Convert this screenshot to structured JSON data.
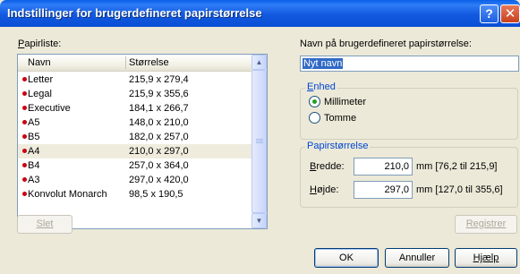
{
  "window": {
    "title": "Indstillinger for brugerdefineret papirstørrelse",
    "help_glyph": "?",
    "close_glyph": "✕"
  },
  "paper_list": {
    "label": "Papirliste:",
    "columns": [
      "Navn",
      "Størrelse"
    ],
    "rows": [
      {
        "name": "Letter",
        "size": "215,9 x 279,4"
      },
      {
        "name": "Legal",
        "size": "215,9 x 355,6"
      },
      {
        "name": "Executive",
        "size": "184,1 x 266,7"
      },
      {
        "name": "A5",
        "size": "148,0 x 210,0"
      },
      {
        "name": "B5",
        "size": "182,0 x 257,0"
      },
      {
        "name": "A4",
        "size": "210,0 x 297,0"
      },
      {
        "name": "B4",
        "size": "257,0 x 364,0"
      },
      {
        "name": "A3",
        "size": "297,0 x 420,0"
      },
      {
        "name": "Konvolut Monarch",
        "size": "98,5 x 190,5"
      }
    ],
    "selected_index": 5,
    "bullet_color": "#c80010"
  },
  "buttons": {
    "delete": "Slet",
    "register": "Registrer",
    "ok": "OK",
    "cancel": "Annuller",
    "help": "Hjælp"
  },
  "custom_name": {
    "label": "Navn på brugerdefineret papirstørrelse:",
    "value": "Nyt navn"
  },
  "unit": {
    "title": "Enhed",
    "options": [
      "Millimeter",
      "Tomme"
    ],
    "selected": "Millimeter"
  },
  "paper_size": {
    "title": "Papirstørrelse",
    "width_label": "Bredde:",
    "width_value": "210,0",
    "width_range": "mm [76,2 til 215,9]",
    "height_label": "Højde:",
    "height_value": "297,0",
    "height_range": "mm [127,0 til 355,6]"
  },
  "colors": {
    "titlebar": "#0a4fd4",
    "dialog_bg": "#ece9d8",
    "group_title": "#0046d5",
    "selection": "#316ac5"
  }
}
